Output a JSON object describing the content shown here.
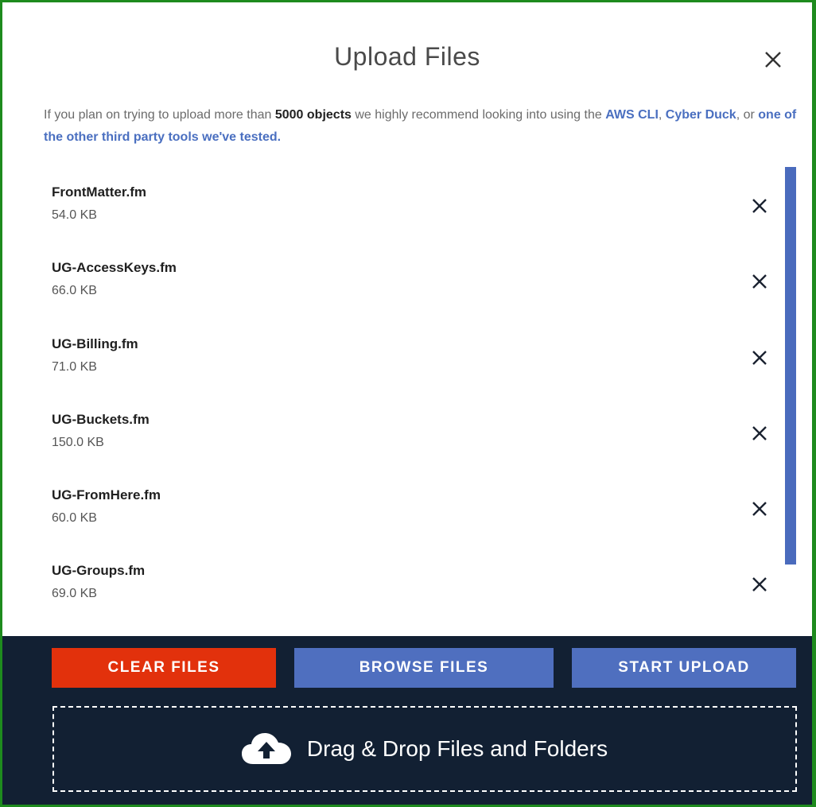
{
  "dialog": {
    "title": "Upload Files"
  },
  "notice": {
    "text_before": "If you plan on trying to upload more than ",
    "bold": "5000 objects",
    "text_middle": " we highly recommend looking into using the ",
    "link_aws": "AWS CLI",
    "sep1": ", ",
    "link_cyberduck": "Cyber Duck",
    "sep2": ", or ",
    "link_other": "one of the other third party tools we've tested."
  },
  "files": [
    {
      "name": "FrontMatter.fm",
      "size": "54.0 KB"
    },
    {
      "name": "UG-AccessKeys.fm",
      "size": "66.0 KB"
    },
    {
      "name": "UG-Billing.fm",
      "size": "71.0 KB"
    },
    {
      "name": "UG-Buckets.fm",
      "size": "150.0 KB"
    },
    {
      "name": "UG-FromHere.fm",
      "size": "60.0 KB"
    },
    {
      "name": "UG-Groups.fm",
      "size": "69.0 KB"
    }
  ],
  "actions": {
    "clear_label": "CLEAR FILES",
    "browse_label": "BROWSE FILES",
    "upload_label": "START UPLOAD"
  },
  "dropzone": {
    "label": "Drag & Drop Files and Folders",
    "icon": "cloud-upload-icon"
  },
  "colors": {
    "danger": "#e2310c",
    "primary": "#4f6fbf",
    "footer_bg": "#122033",
    "link": "#4a6fc0"
  }
}
